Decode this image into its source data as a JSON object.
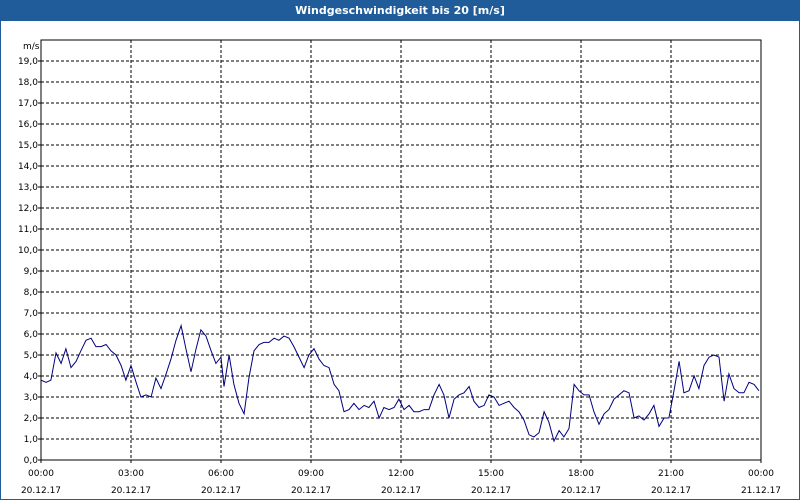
{
  "window": {
    "title": "Windgeschwindigkeit bis 20 [m/s]"
  },
  "colors": {
    "title_bar": "#1f5c99",
    "series_line": "#00007f",
    "grid": "#000000",
    "frame": "#000000"
  },
  "chart_data": {
    "type": "line",
    "ylabel": "m/s",
    "ylim": [
      0,
      20
    ],
    "grid": true,
    "y_ticks": [
      "0,0",
      "1,0",
      "2,0",
      "3,0",
      "4,0",
      "5,0",
      "6,0",
      "7,0",
      "8,0",
      "9,0",
      "10,0",
      "11,0",
      "12,0",
      "13,0",
      "14,0",
      "15,0",
      "16,0",
      "17,0",
      "18,0",
      "19,0"
    ],
    "x_ticks": [
      {
        "time": "00:00",
        "date": "20.12.17",
        "hour": 0
      },
      {
        "time": "03:00",
        "date": "20.12.17",
        "hour": 3
      },
      {
        "time": "06:00",
        "date": "20.12.17",
        "hour": 6
      },
      {
        "time": "09:00",
        "date": "20.12.17",
        "hour": 9
      },
      {
        "time": "12:00",
        "date": "20.12.17",
        "hour": 12
      },
      {
        "time": "15:00",
        "date": "20.12.17",
        "hour": 15
      },
      {
        "time": "18:00",
        "date": "20.12.17",
        "hour": 18
      },
      {
        "time": "21:00",
        "date": "20.12.17",
        "hour": 21
      },
      {
        "time": "00:00",
        "date": "21.12.17",
        "hour": 24
      }
    ],
    "xlim_hours": [
      0,
      24
    ],
    "series": [
      {
        "points": [
          [
            0.0,
            3.8
          ],
          [
            0.17,
            3.7
          ],
          [
            0.33,
            3.8
          ],
          [
            0.5,
            5.1
          ],
          [
            0.67,
            4.6
          ],
          [
            0.83,
            5.3
          ],
          [
            1.0,
            4.4
          ],
          [
            1.17,
            4.7
          ],
          [
            1.33,
            5.2
          ],
          [
            1.5,
            5.7
          ],
          [
            1.67,
            5.8
          ],
          [
            1.83,
            5.4
          ],
          [
            2.0,
            5.4
          ],
          [
            2.17,
            5.5
          ],
          [
            2.33,
            5.2
          ],
          [
            2.5,
            5.0
          ],
          [
            2.67,
            4.5
          ],
          [
            2.83,
            3.8
          ],
          [
            3.0,
            4.5
          ],
          [
            3.17,
            3.7
          ],
          [
            3.33,
            3.0
          ],
          [
            3.5,
            3.1
          ],
          [
            3.67,
            3.0
          ],
          [
            3.83,
            3.9
          ],
          [
            4.0,
            3.4
          ],
          [
            4.17,
            4.1
          ],
          [
            4.33,
            4.8
          ],
          [
            4.5,
            5.7
          ],
          [
            4.67,
            6.4
          ],
          [
            4.83,
            5.3
          ],
          [
            5.0,
            4.2
          ],
          [
            5.17,
            5.3
          ],
          [
            5.33,
            6.2
          ],
          [
            5.5,
            5.9
          ],
          [
            5.67,
            5.2
          ],
          [
            5.83,
            4.6
          ],
          [
            6.0,
            4.9
          ],
          [
            6.1,
            3.5
          ],
          [
            6.27,
            5.0
          ],
          [
            6.43,
            3.6
          ],
          [
            6.6,
            2.7
          ],
          [
            6.77,
            2.2
          ],
          [
            6.93,
            3.9
          ],
          [
            7.1,
            5.2
          ],
          [
            7.27,
            5.5
          ],
          [
            7.43,
            5.6
          ],
          [
            7.6,
            5.6
          ],
          [
            7.77,
            5.8
          ],
          [
            7.93,
            5.7
          ],
          [
            8.1,
            5.9
          ],
          [
            8.27,
            5.8
          ],
          [
            8.43,
            5.4
          ],
          [
            8.6,
            4.9
          ],
          [
            8.77,
            4.4
          ],
          [
            8.93,
            5.0
          ],
          [
            9.1,
            5.3
          ],
          [
            9.27,
            4.8
          ],
          [
            9.43,
            4.5
          ],
          [
            9.6,
            4.4
          ],
          [
            9.77,
            3.6
          ],
          [
            9.93,
            3.3
          ],
          [
            10.1,
            2.3
          ],
          [
            10.27,
            2.4
          ],
          [
            10.43,
            2.7
          ],
          [
            10.6,
            2.4
          ],
          [
            10.77,
            2.6
          ],
          [
            10.93,
            2.5
          ],
          [
            11.1,
            2.8
          ],
          [
            11.27,
            2.0
          ],
          [
            11.43,
            2.5
          ],
          [
            11.6,
            2.4
          ],
          [
            11.77,
            2.5
          ],
          [
            11.93,
            2.9
          ],
          [
            12.1,
            2.4
          ],
          [
            12.27,
            2.6
          ],
          [
            12.43,
            2.3
          ],
          [
            12.6,
            2.3
          ],
          [
            12.77,
            2.4
          ],
          [
            12.93,
            2.4
          ],
          [
            13.1,
            3.1
          ],
          [
            13.27,
            3.6
          ],
          [
            13.43,
            3.1
          ],
          [
            13.6,
            2.0
          ],
          [
            13.77,
            2.9
          ],
          [
            13.93,
            3.1
          ],
          [
            14.1,
            3.2
          ],
          [
            14.27,
            3.5
          ],
          [
            14.43,
            2.8
          ],
          [
            14.6,
            2.5
          ],
          [
            14.77,
            2.6
          ],
          [
            14.93,
            3.1
          ],
          [
            15.1,
            3.0
          ],
          [
            15.27,
            2.6
          ],
          [
            15.43,
            2.7
          ],
          [
            15.6,
            2.8
          ],
          [
            15.77,
            2.5
          ],
          [
            15.93,
            2.3
          ],
          [
            16.1,
            1.9
          ],
          [
            16.27,
            1.2
          ],
          [
            16.43,
            1.1
          ],
          [
            16.6,
            1.3
          ],
          [
            16.77,
            2.3
          ],
          [
            16.93,
            1.8
          ],
          [
            17.1,
            0.9
          ],
          [
            17.27,
            1.4
          ],
          [
            17.43,
            1.1
          ],
          [
            17.6,
            1.5
          ],
          [
            17.77,
            3.6
          ],
          [
            17.93,
            3.3
          ],
          [
            18.1,
            3.1
          ],
          [
            18.27,
            3.1
          ],
          [
            18.43,
            2.3
          ],
          [
            18.6,
            1.7
          ],
          [
            18.77,
            2.2
          ],
          [
            18.93,
            2.4
          ],
          [
            19.1,
            2.9
          ],
          [
            19.27,
            3.1
          ],
          [
            19.43,
            3.3
          ],
          [
            19.6,
            3.2
          ],
          [
            19.77,
            2.0
          ],
          [
            19.93,
            2.1
          ],
          [
            20.1,
            1.9
          ],
          [
            20.27,
            2.2
          ],
          [
            20.43,
            2.6
          ],
          [
            20.6,
            1.6
          ],
          [
            20.77,
            2.0
          ],
          [
            20.93,
            2.0
          ],
          [
            21.1,
            3.3
          ],
          [
            21.27,
            4.7
          ],
          [
            21.43,
            3.2
          ],
          [
            21.6,
            3.3
          ],
          [
            21.77,
            4.0
          ],
          [
            21.93,
            3.4
          ],
          [
            22.1,
            4.5
          ],
          [
            22.27,
            4.9
          ],
          [
            22.43,
            5.0
          ],
          [
            22.6,
            4.9
          ],
          [
            22.77,
            2.8
          ],
          [
            22.93,
            4.1
          ],
          [
            23.1,
            3.4
          ],
          [
            23.27,
            3.2
          ],
          [
            23.43,
            3.2
          ],
          [
            23.6,
            3.7
          ],
          [
            23.77,
            3.6
          ],
          [
            23.93,
            3.3
          ]
        ]
      }
    ]
  }
}
